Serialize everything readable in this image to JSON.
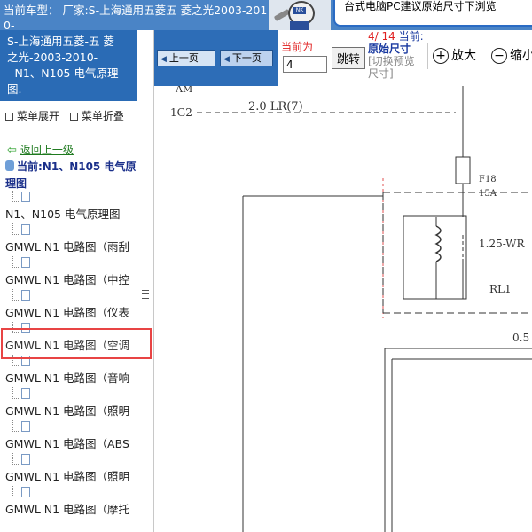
{
  "header": {
    "model_line": "当前车型： 厂家:S-上海通用五菱五 菱之光2003-2010-",
    "notice": "台式电脑PC建议原始尺寸下浏览"
  },
  "sidebar": {
    "title": "S-上海通用五菱-五 菱\n之光-2003-2010-\n- N1、N105 电气原理\n图.",
    "menu_expand": "菜单展开",
    "menu_collapse": "菜单折叠",
    "back_link": "返回上一级",
    "current": "当前:N1、N105 电气原理图",
    "items": [
      {
        "label": "N1、N105 电气原理图"
      },
      {
        "label": "GMWL N1 电路图（雨刮"
      },
      {
        "label": "GMWL N1 电路图（中控"
      },
      {
        "label": "GMWL N1 电路图（仪表"
      },
      {
        "label": "GMWL N1 电路图（空调"
      },
      {
        "label": "GMWL N1 电路图（音响"
      },
      {
        "label": "GMWL N1 电路图（照明"
      },
      {
        "label": "GMWL N1 电路图（ABS"
      },
      {
        "label": "GMWL N1 电路图（照明"
      },
      {
        "label": "GMWL N1 电路图（摩托"
      }
    ],
    "selected_index": 4
  },
  "toolbar": {
    "prev_label": "上一页",
    "next_label": "下一页",
    "current_label": "当前为",
    "page_value": "4",
    "jump_label": "跳转",
    "page_count": "4/ 14",
    "current_text": "当前:",
    "original_size": "原始尺寸",
    "switch_line1": "[切换预览",
    "switch_line2": "尺寸]",
    "zoom_in_label": "放大",
    "zoom_out_label": "缩小"
  },
  "diagram": {
    "label_am": "AM",
    "label_1g2": "1G2",
    "label_wire": "2.0 LR(7)",
    "label_fuse": "F18",
    "label_fuse_amp": "15A",
    "label_wire2": "1.25-WR",
    "label_relay": "RL1",
    "label_dots": "0.5"
  }
}
